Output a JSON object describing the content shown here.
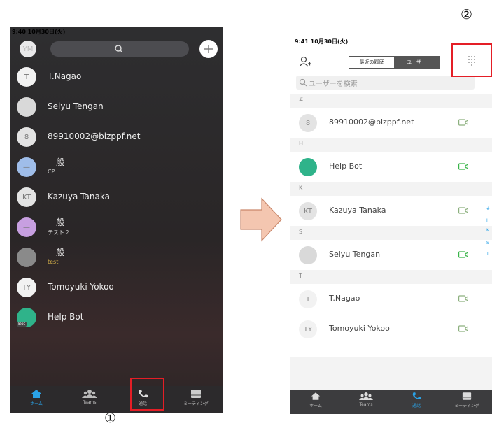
{
  "callouts": {
    "step1": "①",
    "step2": "②"
  },
  "left": {
    "status": "9:40  10月30日(火)",
    "avatar_initials": "YM",
    "contacts": [
      {
        "name": "T.Nagao",
        "initials": "T",
        "avatar_color": "#f2f2f2"
      },
      {
        "name": "Seiyu Tengan",
        "initials": "",
        "avatar_color": "#d9d9d9"
      },
      {
        "name": "89910002@bizppf.net",
        "initials": "8",
        "avatar_color": "#e3e3e3"
      },
      {
        "name": "一般",
        "sub": "CP",
        "initials": "—",
        "avatar_color": "#9fbde9"
      },
      {
        "name": "Kazuya Tanaka",
        "initials": "KT",
        "avatar_color": "#e3e3e3"
      },
      {
        "name": "一般",
        "sub": "テスト２",
        "initials": "—",
        "avatar_color": "#c79fe0"
      },
      {
        "name": "一般",
        "sub": "test",
        "initials": "",
        "avatar_color": "#8a8a8a"
      },
      {
        "name": "Tomoyuki Yokoo",
        "initials": "TY",
        "avatar_color": "#f2f2f2"
      },
      {
        "name": "Help Bot",
        "initials": "",
        "avatar_color": "#2fb38a",
        "badge": "Bot"
      }
    ],
    "tabs": [
      {
        "label": "ホーム",
        "icon": "home-icon"
      },
      {
        "label": "Teams",
        "icon": "teams-icon"
      },
      {
        "label": "通話",
        "icon": "phone-icon"
      },
      {
        "label": "ミーティング",
        "icon": "calendar-icon"
      }
    ]
  },
  "right": {
    "status": "9:41  10月30日(火)",
    "segments": [
      "最近の履歴",
      "ユーザー"
    ],
    "search_placeholder": "ユーザーを検索",
    "sections": [
      {
        "header": "#",
        "rows": [
          {
            "name": "89910002@bizppf.net",
            "initials": "8",
            "avatar_color": "#e3e3e3"
          }
        ]
      },
      {
        "header": "H",
        "rows": [
          {
            "name": "Help Bot",
            "initials": "",
            "avatar_color": "#2fb38a"
          }
        ]
      },
      {
        "header": "K",
        "rows": [
          {
            "name": "Kazuya Tanaka",
            "initials": "KT",
            "avatar_color": "#e3e3e3"
          }
        ]
      },
      {
        "header": "S",
        "rows": [
          {
            "name": "Seiyu Tengan",
            "initials": "",
            "avatar_color": "#d9d9d9"
          }
        ]
      },
      {
        "header": "T",
        "rows": [
          {
            "name": "T.Nagao",
            "initials": "T",
            "avatar_color": "#f2f2f2"
          },
          {
            "name": "Tomoyuki Yokoo",
            "initials": "TY",
            "avatar_color": "#f2f2f2"
          }
        ]
      }
    ],
    "index_letters": [
      "#",
      "H",
      "K",
      "S",
      "T"
    ],
    "tabs": [
      {
        "label": "ホーム",
        "icon": "home-icon"
      },
      {
        "label": "Teams",
        "icon": "teams-icon"
      },
      {
        "label": "通話",
        "icon": "phone-icon"
      },
      {
        "label": "ミーティング",
        "icon": "calendar-icon"
      }
    ]
  },
  "colors": {
    "accent": "#2aa3e8",
    "highlight": "#e41e26",
    "video": "#3ab54a",
    "arrow": "#f4c6b0"
  }
}
